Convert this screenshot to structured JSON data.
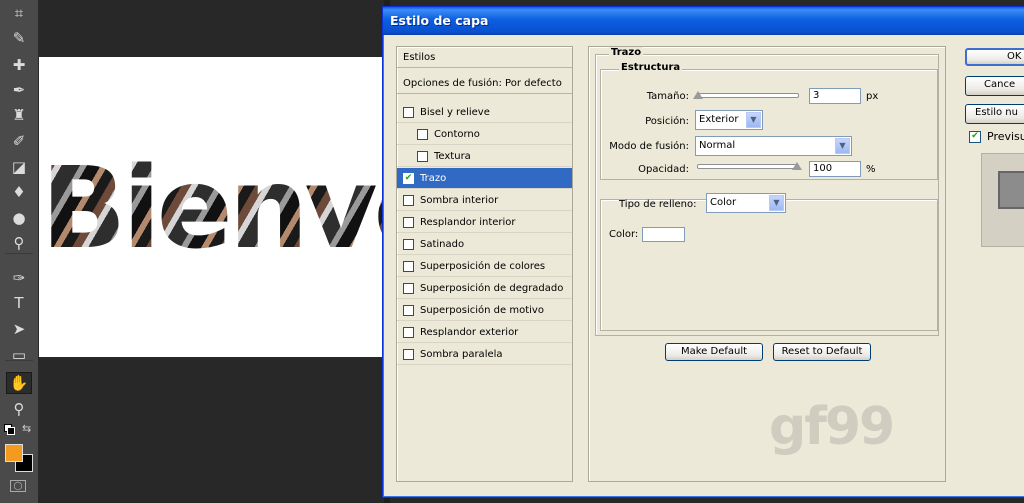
{
  "toolbar": {
    "tools": [
      {
        "name": "crop-tool-icon",
        "glyph": "⌗"
      },
      {
        "name": "eyedropper-tool-icon",
        "glyph": "✎"
      },
      {
        "name": "healing-brush-tool-icon",
        "glyph": "✚"
      },
      {
        "name": "brush-tool-icon",
        "glyph": "✒"
      },
      {
        "name": "clone-stamp-tool-icon",
        "glyph": "♜"
      },
      {
        "name": "history-brush-tool-icon",
        "glyph": "✐"
      },
      {
        "name": "eraser-tool-icon",
        "glyph": "◪"
      },
      {
        "name": "paint-bucket-tool-icon",
        "glyph": "♦"
      },
      {
        "name": "blur-tool-icon",
        "glyph": "●"
      },
      {
        "name": "dodge-tool-icon",
        "glyph": "⚲"
      },
      {
        "name": "pen-tool-icon",
        "glyph": "✑"
      },
      {
        "name": "type-tool-icon",
        "glyph": "T"
      },
      {
        "name": "path-selection-tool-icon",
        "glyph": "➤"
      },
      {
        "name": "rectangle-tool-icon",
        "glyph": "▭"
      },
      {
        "name": "hand-tool-icon",
        "glyph": "✋"
      },
      {
        "name": "zoom-tool-icon",
        "glyph": "⚲"
      }
    ],
    "foreground_color": "#f39a21",
    "background_color": "#000000"
  },
  "canvas": {
    "text": "Bienve"
  },
  "dialog": {
    "title": "Estilo de capa",
    "styles_header": "Estilos",
    "blend_options": "Opciones de fusión: Por defecto",
    "style_items": [
      {
        "label": "Bisel y relieve",
        "checked": false,
        "indent": false,
        "selected": false
      },
      {
        "label": "Contorno",
        "checked": false,
        "indent": true,
        "selected": false
      },
      {
        "label": "Textura",
        "checked": false,
        "indent": true,
        "selected": false
      },
      {
        "label": "Trazo",
        "checked": true,
        "indent": false,
        "selected": true
      },
      {
        "label": "Sombra interior",
        "checked": false,
        "indent": false,
        "selected": false
      },
      {
        "label": "Resplandor interior",
        "checked": false,
        "indent": false,
        "selected": false
      },
      {
        "label": "Satinado",
        "checked": false,
        "indent": false,
        "selected": false
      },
      {
        "label": "Superposición de colores",
        "checked": false,
        "indent": false,
        "selected": false
      },
      {
        "label": "Superposición de degradado",
        "checked": false,
        "indent": false,
        "selected": false
      },
      {
        "label": "Superposición de motivo",
        "checked": false,
        "indent": false,
        "selected": false
      },
      {
        "label": "Resplandor exterior",
        "checked": false,
        "indent": false,
        "selected": false
      },
      {
        "label": "Sombra paralela",
        "checked": false,
        "indent": false,
        "selected": false
      }
    ],
    "stroke": {
      "group_title": "Trazo",
      "structure_title": "Estructura",
      "size_label": "Tamaño:",
      "size_value": "3",
      "size_unit": "px",
      "size_slider_fraction": 0.01,
      "position_label": "Posición:",
      "position_value": "Exterior",
      "blend_mode_label": "Modo de fusión:",
      "blend_mode_value": "Normal",
      "opacity_label": "Opacidad:",
      "opacity_value": "100",
      "opacity_unit": "%",
      "opacity_slider_fraction": 1.0,
      "fill_type_label": "Tipo de relleno:",
      "fill_type_value": "Color",
      "color_label": "Color:",
      "color_value": "#ffffff"
    },
    "make_default_label": "Make Default",
    "reset_default_label": "Reset to Default",
    "ok_label": "OK",
    "cancel_label": "Cance",
    "new_style_label": "Estilo nu",
    "preview_label": "Previsu",
    "preview_checked": true,
    "watermark": "gf99"
  }
}
